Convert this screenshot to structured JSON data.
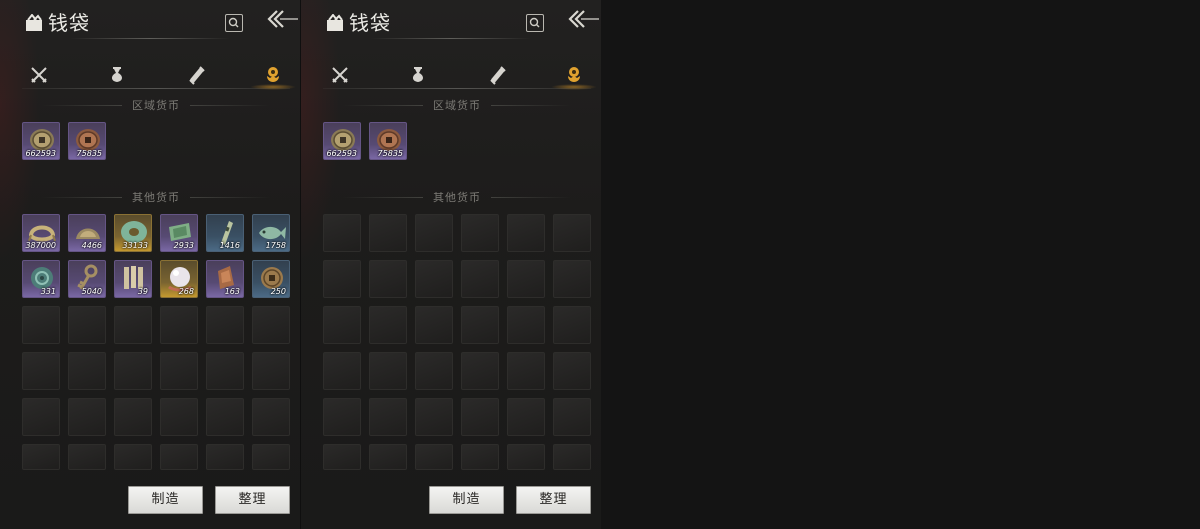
{
  "panels": [
    {
      "title": "钱袋",
      "tabs": [
        {
          "icon": "crossed-swords-icon"
        },
        {
          "icon": "pouch-icon"
        },
        {
          "icon": "scroll-icon"
        },
        {
          "icon": "coin-pouch-icon",
          "active": true
        }
      ],
      "sections": [
        {
          "title": "区域货币",
          "items": [
            {
              "icon": "bronze-coin-icon",
              "quantity": "662593",
              "rarity": "purple"
            },
            {
              "icon": "copper-coin-icon",
              "quantity": "75835",
              "rarity": "purple"
            }
          ]
        },
        {
          "title": "其他货币",
          "items": [
            {
              "icon": "coin-string-icon",
              "quantity": "387000",
              "rarity": "purple"
            },
            {
              "icon": "bronze-ingot-icon",
              "quantity": "4466",
              "rarity": "purple"
            },
            {
              "icon": "jade-disc-icon",
              "quantity": "33133",
              "rarity": "gold"
            },
            {
              "icon": "banknote-icon",
              "quantity": "2933",
              "rarity": "purple"
            },
            {
              "icon": "jade-token-icon",
              "quantity": "1416",
              "rarity": "blue"
            },
            {
              "icon": "jade-fish-icon",
              "quantity": "1758",
              "rarity": "blue"
            },
            {
              "icon": "teal-ornament-icon",
              "quantity": "331",
              "rarity": "purple"
            },
            {
              "icon": "bronze-key-icon",
              "quantity": "5040",
              "rarity": "purple"
            },
            {
              "icon": "bamboo-slips-icon",
              "quantity": "39",
              "rarity": "purple"
            },
            {
              "icon": "pearl-icon",
              "quantity": "268",
              "rarity": "gold"
            },
            {
              "icon": "copper-tablet-icon",
              "quantity": "163",
              "rarity": "purple"
            },
            {
              "icon": "old-coin-icon",
              "quantity": "250",
              "rarity": "blue"
            }
          ]
        }
      ],
      "buttons": {
        "craft": "制造",
        "sort": "整理"
      }
    },
    {
      "title": "钱袋",
      "tabs": [
        {
          "icon": "crossed-swords-icon"
        },
        {
          "icon": "pouch-icon"
        },
        {
          "icon": "scroll-icon"
        },
        {
          "icon": "coin-pouch-icon",
          "active": true
        }
      ],
      "sections": [
        {
          "title": "区域货币",
          "items": [
            {
              "icon": "bronze-coin-icon",
              "quantity": "662593",
              "rarity": "purple"
            },
            {
              "icon": "copper-coin-icon",
              "quantity": "75835",
              "rarity": "purple"
            }
          ]
        },
        {
          "title": "其他货币",
          "items": []
        }
      ],
      "buttons": {
        "craft": "制造",
        "sort": "整理"
      }
    }
  ],
  "colors": {
    "purple": "#574a73",
    "gold": "#c4992f",
    "blue": "#4c6b86",
    "active_tab": "#e0a22f"
  }
}
